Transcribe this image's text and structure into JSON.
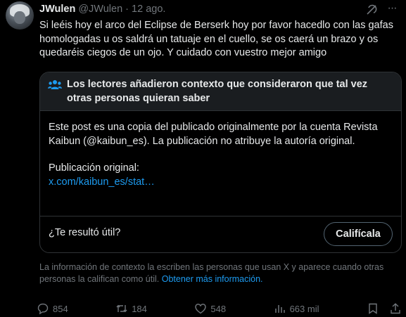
{
  "author": {
    "name": "JWulen",
    "handle": "@JWulen",
    "separator": "·",
    "date": "12 ago."
  },
  "tweet": {
    "text": "Si leéis hoy el arco del Eclipse de Berserk hoy por favor hacedlo con las gafas homologadas u os saldrá un tatuaje en el cuello, se os caerá un brazo y os quedaréis ciegos de un ojo. Y cuidado con vuestro mejor amigo"
  },
  "community_note": {
    "title": "Los lectores añadieron contexto que consideraron que tal vez otras personas quieran saber",
    "body": "Este post es una copia del publicado originalmente por la cuenta Revista Kaibun (@kaibun_es). La publicación no atribuye la autoría original.",
    "original_label": "Publicación original:",
    "link": "x.com/kaibun_es/stat…",
    "helpful_question": "¿Te resultó útil?",
    "rate_button": "Califícala"
  },
  "disclaimer": {
    "text": "La información de contexto la escriben las personas que usan X y aparece cuando otras personas la califican como útil.",
    "link": "Obtener más información."
  },
  "actions": {
    "replies": "854",
    "reposts": "184",
    "likes": "548",
    "views": "663 mil"
  },
  "colors": {
    "background": "#000000",
    "text": "#e7e9ea",
    "secondary": "#71767b",
    "accent": "#1d9bf0",
    "note_header": "#1a1d20",
    "border": "#2f3336"
  },
  "icons": [
    "grok-icon",
    "more-icon",
    "people-icon",
    "reply-icon",
    "repost-icon",
    "like-icon",
    "views-icon",
    "bookmark-icon",
    "share-icon"
  ]
}
